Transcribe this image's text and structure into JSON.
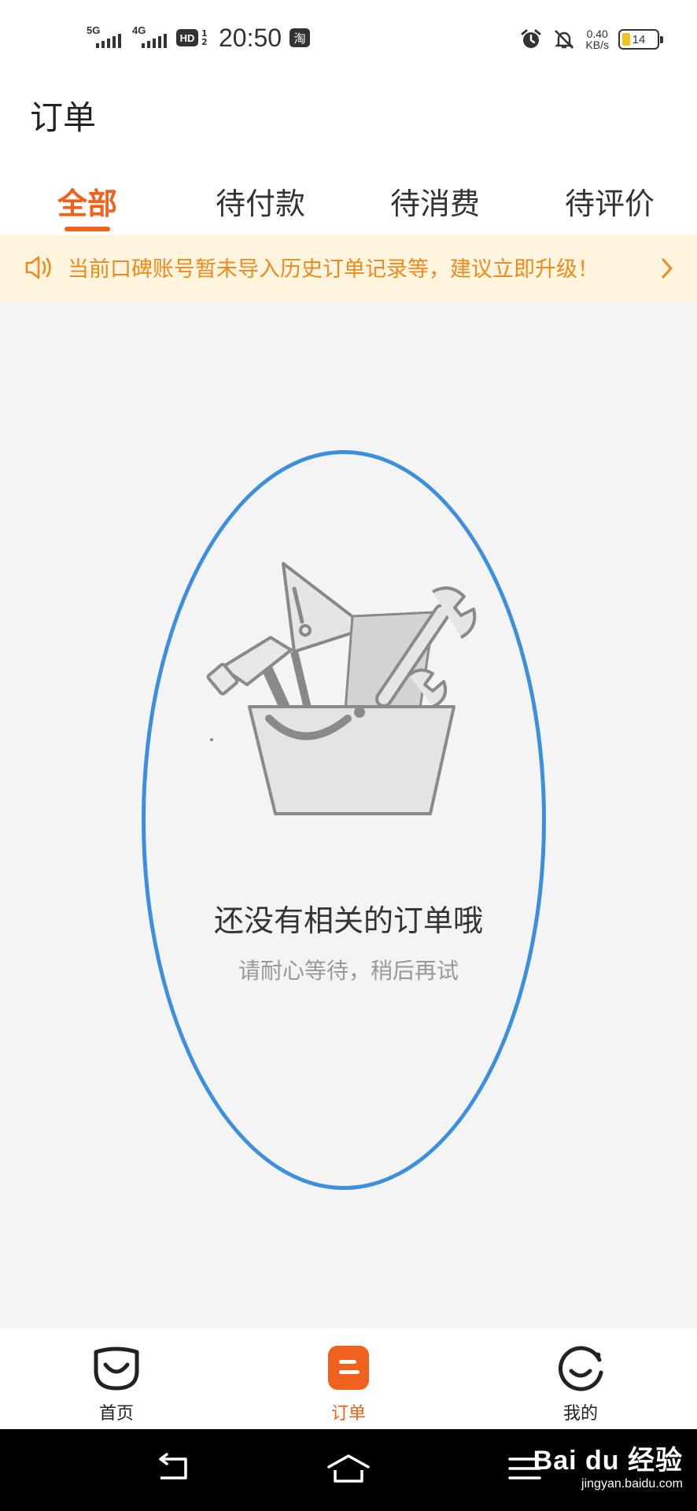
{
  "status_bar": {
    "signal1_label": "5G",
    "signal2_label": "4G",
    "hd_label": "HD",
    "hd_sub": "1 2",
    "time": "20:50",
    "app_badge": "淘",
    "net_speed_value": "0.40",
    "net_speed_unit": "KB/s",
    "battery_level": "14"
  },
  "header": {
    "title": "订单"
  },
  "tabs": [
    {
      "label": "全部",
      "active": true
    },
    {
      "label": "待付款",
      "active": false
    },
    {
      "label": "待消费",
      "active": false
    },
    {
      "label": "待评价",
      "active": false
    }
  ],
  "notice": {
    "text": "当前口碑账号暂未导入历史订单记录等，建议立即升级！"
  },
  "empty_state": {
    "title": "还没有相关的订单哦",
    "subtitle": "请耐心等待，稍后再试"
  },
  "bottom_nav": [
    {
      "label": "首页",
      "icon": "home-smile-icon",
      "active": false
    },
    {
      "label": "订单",
      "icon": "orders-icon",
      "active": true
    },
    {
      "label": "我的",
      "icon": "profile-smile-icon",
      "active": false
    }
  ],
  "system_nav": {
    "back": "back-icon",
    "home": "home-icon",
    "menu": "menu-icon"
  },
  "watermark": {
    "logo": "Bai du 经验",
    "url": "jingyan.baidu.com"
  },
  "colors": {
    "accent": "#f0611c",
    "notice_text": "#f08a1c",
    "notice_bg": "#fff5df",
    "highlight": "#3c8fdc"
  }
}
